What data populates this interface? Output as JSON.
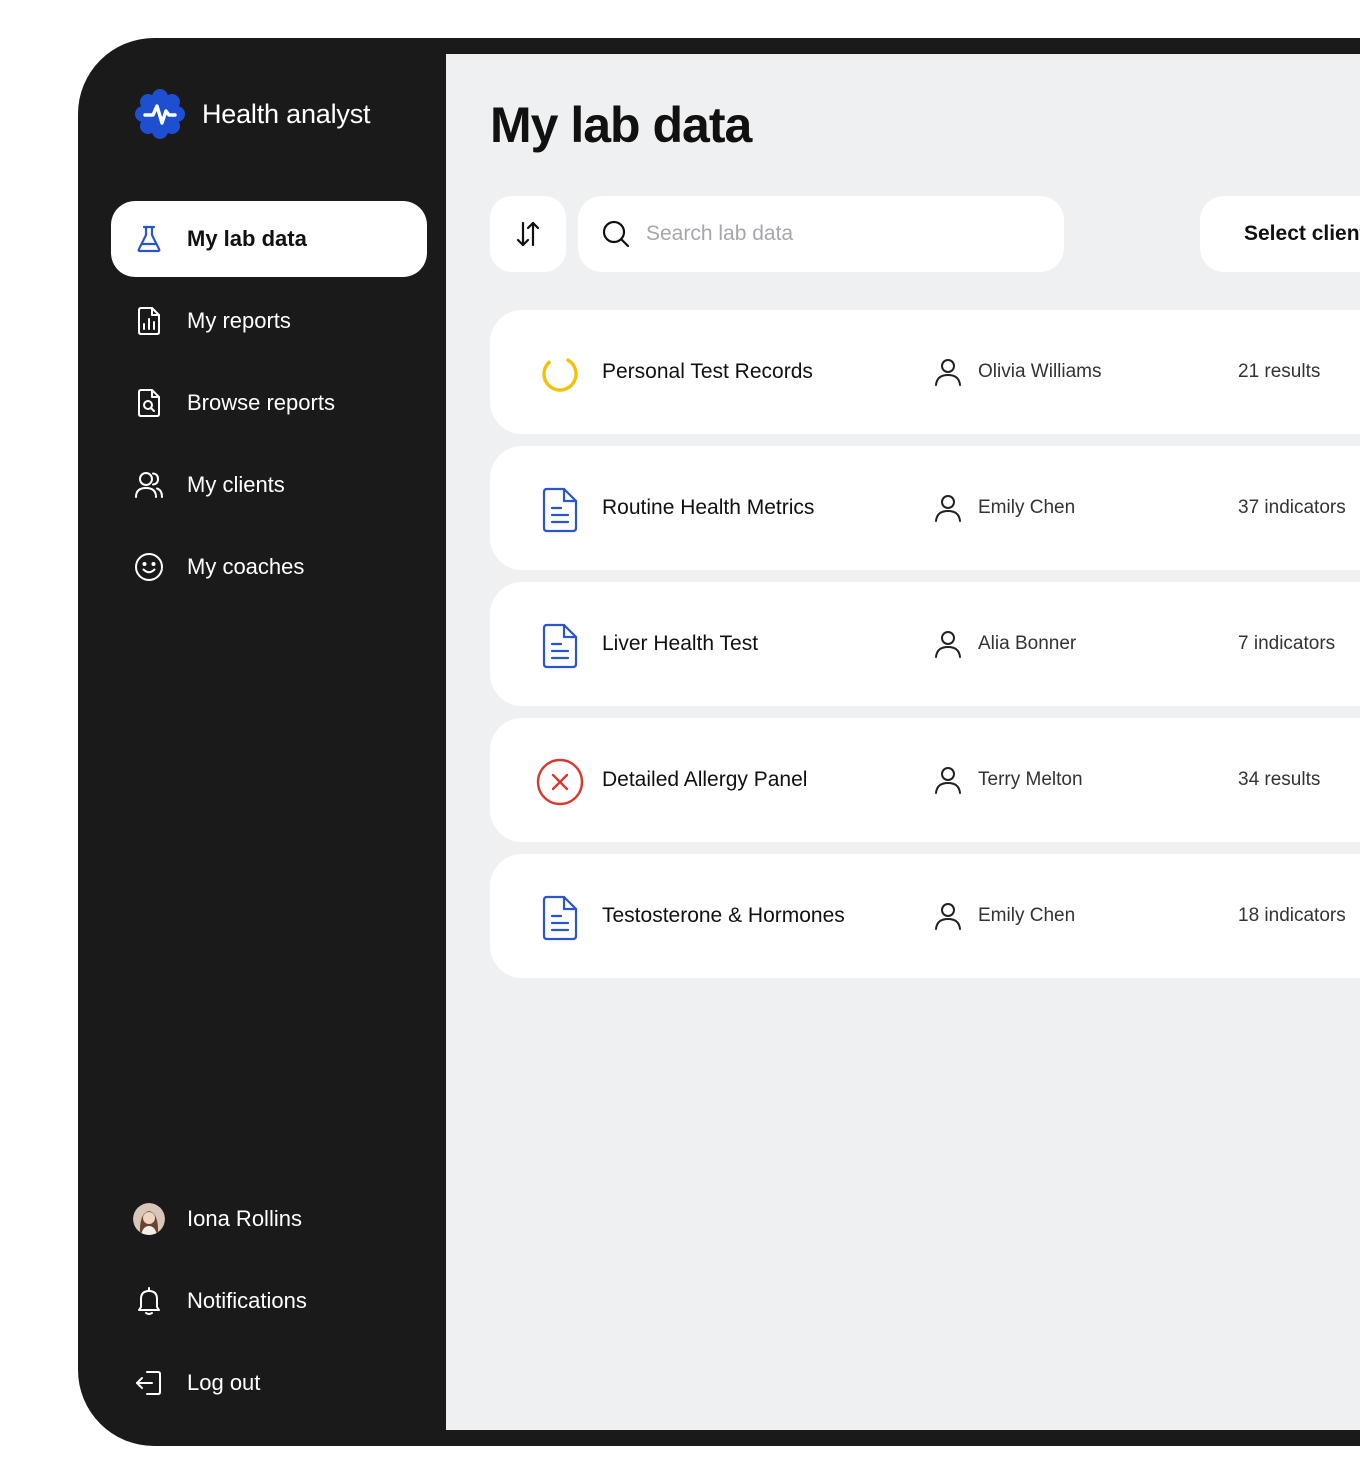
{
  "app": {
    "name": "Health analyst"
  },
  "sidebar": {
    "items": [
      {
        "label": "My lab data",
        "icon": "flask-icon",
        "active": true
      },
      {
        "label": "My reports",
        "icon": "report-chart-icon"
      },
      {
        "label": "Browse reports",
        "icon": "search-document-icon"
      },
      {
        "label": "My clients",
        "icon": "users-icon"
      },
      {
        "label": "My coaches",
        "icon": "smiley-icon"
      }
    ],
    "footer": {
      "user_name": "Iona Rollins",
      "notifications_label": "Notifications",
      "logout_label": "Log out"
    }
  },
  "main": {
    "title": "My lab data",
    "search": {
      "placeholder": "Search lab data",
      "value": ""
    },
    "select_client_label": "Select client",
    "rows": [
      {
        "name": "Personal Test Records",
        "status": "loading",
        "client": "Olivia Williams",
        "count": "21 results"
      },
      {
        "name": "Routine Health Metrics",
        "status": "document",
        "client": "Emily Chen",
        "count": "37 indicators"
      },
      {
        "name": "Liver Health Test",
        "status": "document",
        "client": "Alia Bonner",
        "count": "7 indicators"
      },
      {
        "name": "Detailed Allergy Panel",
        "status": "error",
        "client": "Terry Melton",
        "count": "34 results"
      },
      {
        "name": "Testosterone & Hormones",
        "status": "document",
        "client": "Emily Chen",
        "count": "18 indicators"
      }
    ]
  },
  "colors": {
    "sidebar_bg": "#1a1a1a",
    "content_bg": "#eff0f1",
    "brand_blue": "#1f4fd1",
    "loading_yellow": "#f2c10a",
    "error_red": "#d63a2f",
    "document_blue": "#2a54c9"
  }
}
